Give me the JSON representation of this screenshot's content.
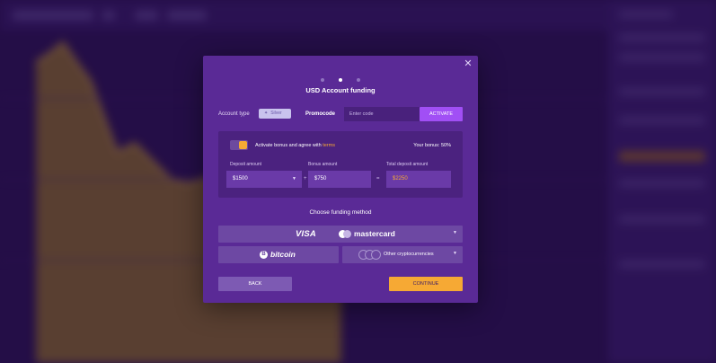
{
  "modal": {
    "title": "USD Account funding",
    "close_icon": "close-icon",
    "steps": {
      "total": 3,
      "current": 2
    }
  },
  "account": {
    "label": "Account type",
    "type_value": "Silver",
    "type_icon": "sparkle-icon"
  },
  "promo": {
    "label": "Promocode",
    "placeholder": "Enter code",
    "activate_label": "ACTIVATE"
  },
  "bonus": {
    "agree_text": "Activate bonus and agree with",
    "terms_link": "terms",
    "your_bonus": "Your bonus: 50%",
    "deposit_label": "Deposit amount",
    "deposit_value": "$1500",
    "plus": "+",
    "bonus_label": "Bonus amount",
    "bonus_value": "$750",
    "equals": "=",
    "total_label": "Total deposit amount",
    "total_value": "$2250"
  },
  "funding": {
    "heading": "Choose funding method",
    "cards_visa": "VISA",
    "cards_mastercard": "mastercard",
    "bitcoin_symbol": "B",
    "bitcoin": "bitcoin",
    "crypto": "Other cryptocurrencies"
  },
  "footer": {
    "back_label": "BACK",
    "continue_label": "CONTINUE"
  },
  "colors": {
    "modal_bg": "#5a2a96",
    "accent_purple": "#a14ff5",
    "accent_orange": "#f6a934"
  }
}
